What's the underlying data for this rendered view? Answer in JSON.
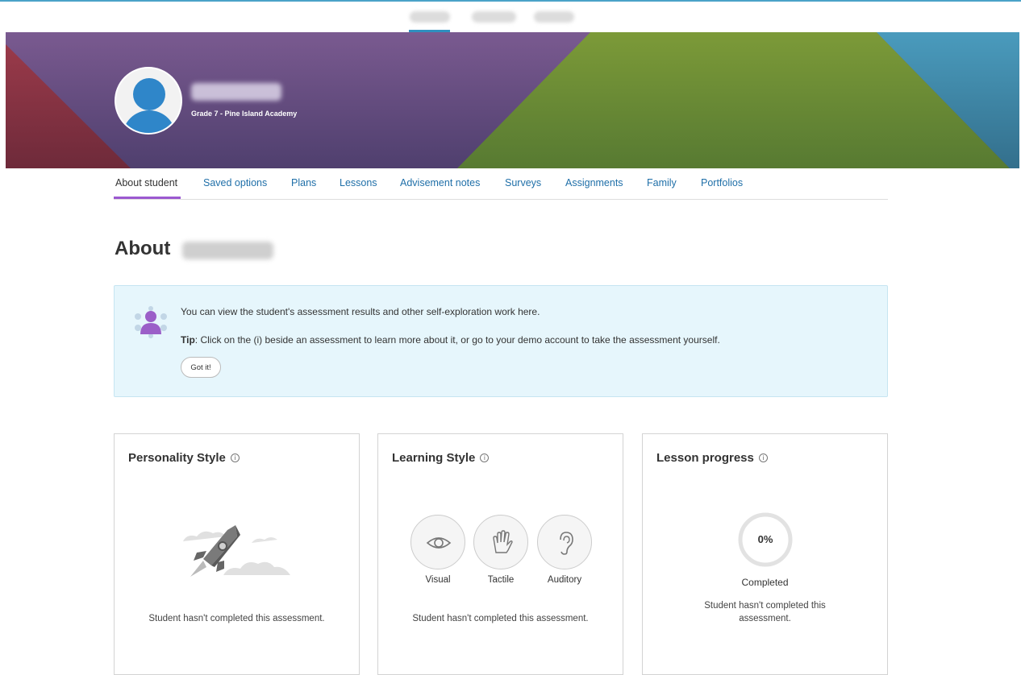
{
  "topnav": {
    "tabs": [
      {
        "label": ""
      },
      {
        "label": ""
      },
      {
        "label": ""
      }
    ]
  },
  "student": {
    "name": "",
    "grade_school": "Grade 7 - Pine Island Academy"
  },
  "subnav": {
    "items": [
      {
        "label": "About student",
        "active": true
      },
      {
        "label": "Saved options"
      },
      {
        "label": "Plans"
      },
      {
        "label": "Lessons"
      },
      {
        "label": "Advisement notes"
      },
      {
        "label": "Surveys"
      },
      {
        "label": "Assignments"
      },
      {
        "label": "Family"
      },
      {
        "label": "Portfolios"
      }
    ]
  },
  "page": {
    "title_prefix": "About",
    "title_name": ""
  },
  "tip": {
    "line1": "You can view the student's assessment results and other self-exploration work here.",
    "tip_label": "Tip",
    "tip_text": ": Click on the (i) beside an assessment to learn more about it, or go to your demo account to take the assessment yourself.",
    "button": "Got it!"
  },
  "cards": {
    "personality": {
      "title": "Personality Style",
      "info": "i",
      "message": "Student hasn't completed this assessment."
    },
    "learning": {
      "title": "Learning Style",
      "info": "i",
      "styles": [
        {
          "label": "Visual",
          "icon": "eye-icon"
        },
        {
          "label": "Tactile",
          "icon": "hand-icon"
        },
        {
          "label": "Auditory",
          "icon": "ear-icon"
        }
      ],
      "message": "Student hasn't completed this assessment."
    },
    "lesson": {
      "title": "Lesson progress",
      "info": "i",
      "percent": "0%",
      "progress_value": 0,
      "caption": "Completed",
      "message_line1": "Student hasn't completed this",
      "message_line2": "assessment."
    }
  },
  "colors": {
    "link": "#1f6fa8",
    "active_tab": "#9b59d0",
    "tip_bg": "#e6f6fc",
    "banner_purple": "#5e4a86",
    "banner_green": "#6b8c3a",
    "banner_teal": "#3d8aa8",
    "banner_red": "#8a3344"
  }
}
